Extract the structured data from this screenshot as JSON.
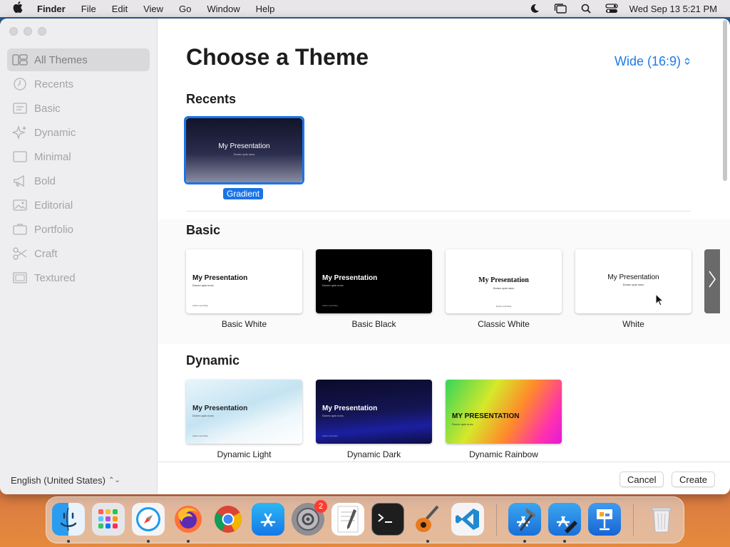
{
  "menubar": {
    "app_name": "Finder",
    "menus": [
      "File",
      "Edit",
      "View",
      "Go",
      "Window",
      "Help"
    ],
    "clock": "Wed Sep 13  5:21 PM"
  },
  "sidebar": {
    "items": [
      {
        "label": "All Themes",
        "icon": "grid-icon"
      },
      {
        "label": "Recents",
        "icon": "clock-icon"
      },
      {
        "label": "Basic",
        "icon": "slide-icon"
      },
      {
        "label": "Dynamic",
        "icon": "sparkle-icon"
      },
      {
        "label": "Minimal",
        "icon": "square-icon"
      },
      {
        "label": "Bold",
        "icon": "megaphone-icon"
      },
      {
        "label": "Editorial",
        "icon": "photo-icon"
      },
      {
        "label": "Portfolio",
        "icon": "briefcase-icon"
      },
      {
        "label": "Craft",
        "icon": "scissors-icon"
      },
      {
        "label": "Textured",
        "icon": "frame-icon"
      }
    ],
    "language": "English (United States)"
  },
  "main": {
    "title": "Choose a Theme",
    "aspect_ratio": "Wide (16:9)",
    "sections": [
      {
        "title": "Recents",
        "themes": [
          {
            "name": "Gradient",
            "slide_title": "My Presentation",
            "slide_subtitle": "Donec quis nunc",
            "selected": true
          }
        ]
      },
      {
        "title": "Basic",
        "themes": [
          {
            "name": "Basic White",
            "slide_title": "My Presentation",
            "slide_subtitle": "Donec quis nunc",
            "author": "Author and Date"
          },
          {
            "name": "Basic Black",
            "slide_title": "My Presentation",
            "slide_subtitle": "Donec quis nunc",
            "author": "Author and Date"
          },
          {
            "name": "Classic White",
            "slide_title": "My Presentation",
            "slide_subtitle": "Donec quis nunc",
            "author": "Author and Date"
          },
          {
            "name": "White",
            "slide_title": "My Presentation",
            "slide_subtitle": "Donec quis nunc"
          }
        ]
      },
      {
        "title": "Dynamic",
        "themes": [
          {
            "name": "Dynamic Light",
            "slide_title": "My Presentation",
            "slide_subtitle": "Donec quis nunc",
            "author": "Author and Date"
          },
          {
            "name": "Dynamic Dark",
            "slide_title": "My Presentation",
            "slide_subtitle": "Donec quis nunc",
            "author": "Author and Date"
          },
          {
            "name": "Dynamic Rainbow",
            "slide_title": "MY PRESENTATION",
            "slide_subtitle": "Donec quis nunc"
          }
        ]
      }
    ]
  },
  "footer": {
    "cancel_label": "Cancel",
    "create_label": "Create"
  },
  "dock": {
    "apps": [
      "Finder",
      "Launchpad",
      "Safari",
      "Firefox",
      "Chrome",
      "App Store",
      "System Settings",
      "TextEdit",
      "Terminal",
      "GarageBand",
      "Visual Studio Code",
      "Xcode",
      "Simulator",
      "Keynote",
      "Trash"
    ],
    "settings_badge": "2"
  },
  "colors": {
    "accent": "#1a74e8",
    "link": "#1b7bea"
  }
}
